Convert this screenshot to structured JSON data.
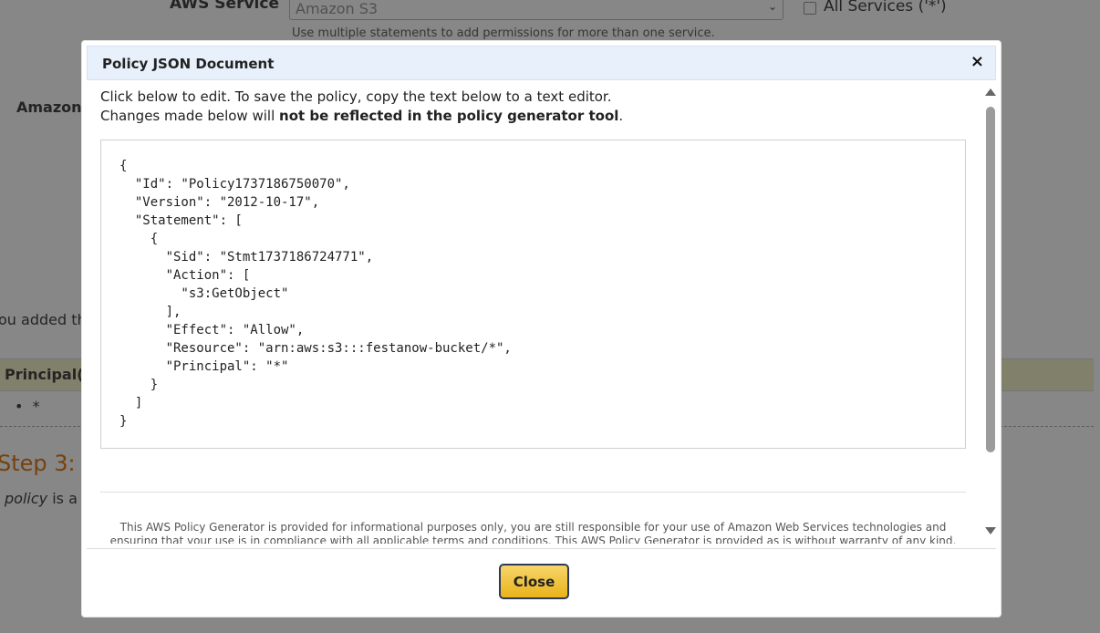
{
  "background": {
    "service_label": "AWS Service",
    "service_select_value": "Amazon S3",
    "all_services_label": "All Services ('*')",
    "service_hint": "Use multiple statements to add permissions for more than one service.",
    "amazon_label": "Amazon",
    "added_text": "ou added th",
    "principal_label": "Principal(",
    "principal_value": "*",
    "step_heading": "Step 3:",
    "policy_word": "policy",
    "policy_rest": " is a"
  },
  "modal": {
    "title": "Policy JSON Document",
    "close_icon": "×",
    "intro_line1": "Click below to edit. To save the policy, copy the text below to a text editor.",
    "intro_line2_prefix": "Changes made below will ",
    "intro_line2_bold": "not be reflected in the policy generator tool",
    "intro_line2_suffix": ".",
    "policy_json": "{\n  \"Id\": \"Policy1737186750070\",\n  \"Version\": \"2012-10-17\",\n  \"Statement\": [\n    {\n      \"Sid\": \"Stmt1737186724771\",\n      \"Action\": [\n        \"s3:GetObject\"\n      ],\n      \"Effect\": \"Allow\",\n      \"Resource\": \"arn:aws:s3:::festanow-bucket/*\",\n      \"Principal\": \"*\"\n    }\n  ]\n}",
    "disclaimer": "This AWS Policy Generator is provided for informational purposes only, you are still responsible for your use of Amazon Web Services technologies and ensuring that your use is in compliance with all applicable terms and conditions. This AWS Policy Generator is provided as is without warranty of any kind, whether",
    "close_button_label": "Close"
  }
}
